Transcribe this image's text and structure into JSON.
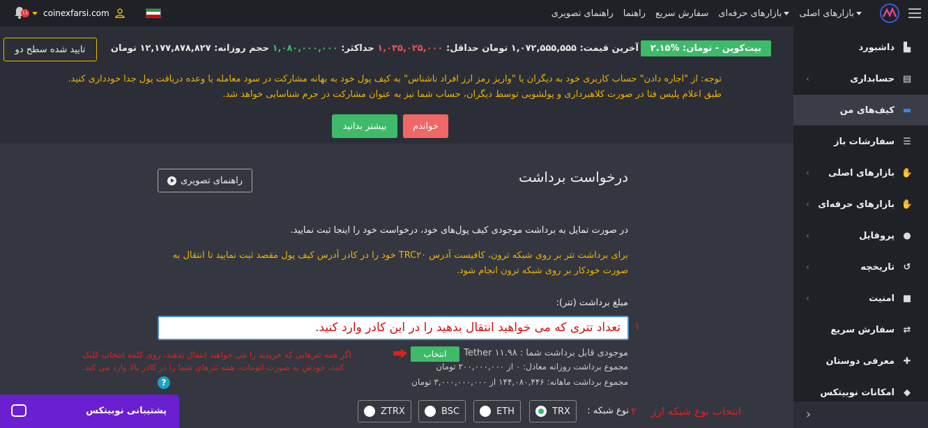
{
  "topnav": {
    "links": [
      "بازارهای اصلی",
      "بازارهای حرفه‌ای",
      "سفارش سریع",
      "راهنما",
      "راهنمای تصویری"
    ],
    "site": "coinexfarsi.com",
    "notif_count": "۱۱"
  },
  "price": {
    "pair": "بیت‌کوین - تومان: %۲.۱۵",
    "last_label": "آخرین قیمت:",
    "last": "۱,۰۷۲,۵۵۵,۵۵۵",
    "last_unit": "تومان",
    "min_label": "حداقل:",
    "min": "۱,۰۳۵,۰۲۵,۰۰۰",
    "max_label": "حداکثر:",
    "max": "۱,۰۸۰,۰۰۰,۰۰۰",
    "volume_label": "حجم روزانه:",
    "volume": "۱۲,۱۷۷,۸۷۸,۸۲۷",
    "volume_unit": "تومان",
    "verify": "تایید شده سطح دو"
  },
  "warning": {
    "line1": "توجه: از \"اجاره دادن\" حساب کاربری خود به دیگران یا \"واریز رمز ارز افراد ناشناس\" به کیف پول خود به بهانه مشارکت در سود معامله یا وعده دریافت پول جدا خودداری کنید.",
    "line2": "طبق اعلام پلیس فتا در صورت کلاهبرداری و پولشویی توسط دیگران، حساب شما نیز به عنوان مشارکت در جرم شناسایی خواهد شد.",
    "read": "خواندم",
    "more": "بیشتر بدانید"
  },
  "sidebar": {
    "items": [
      "داشبورد",
      "حسابداری",
      "کیف‌های من",
      "سفارشات باز",
      "بازارهای اصلی",
      "بازارهای حرفه‌ای",
      "پروفایل",
      "تاریخچه",
      "امنیت",
      "سفارش سریع",
      "معرفی دوستان",
      "امکانات نوبیتکس"
    ]
  },
  "withdraw": {
    "title": "درخواست برداشت",
    "guide": "راهنمای تصویری",
    "intro": "در صورت تمایل به برداشت موجودی کیف پول‌های خود، درخواست خود را اینجا ثبت نمایید.",
    "trc_line1": "برای برداشت تتر بر روی شبکه ترون، کافیست آدرس TRC۲۰ خود را در کادر آدرس کیف پول مقصد ثبت نمایید تا انتقال به",
    "trc_line2": "صورت خودکار بر روی شبکه ترون انجام شود.",
    "amount_label": "مبلغ برداشت (تتر):",
    "amount_value": "تعداد تتری که می خواهید انتقال بدهید را در این کادر وارد کنید.",
    "step1": "۱",
    "available": "موجودی قابل برداشت شما : Tether ۱۱.۹۸",
    "select": "انتخاب",
    "daily": "مجموع برداشت روزانه معادل: ۰ از ۲۰۰,۰۰۰,۰۰۰ تومان",
    "monthly": "مجموع برداشت ماهانه: ۱۴۴,۰۸۰,۴۴۶ از ۳,۰۰۰,۰۰۰,۰۰۰ تومان",
    "hint1": "اگر همه تترهایی که خریدید را می خواهید انتقال بدهید، روی کلمه انتخاب کلیک",
    "hint2": "کنید، خودش به صورت اتومات، همه تترهای شما را در کادر بالا وارد می کند.",
    "network_hint": "انتخاب نوع شبکه ارز",
    "step2": "۲",
    "network_label": "نوع شبکه :",
    "networks": [
      "TRX",
      "ETH",
      "BSC",
      "ZTRX"
    ]
  },
  "support": {
    "label": "پشتیبانی نوبیتکس"
  }
}
